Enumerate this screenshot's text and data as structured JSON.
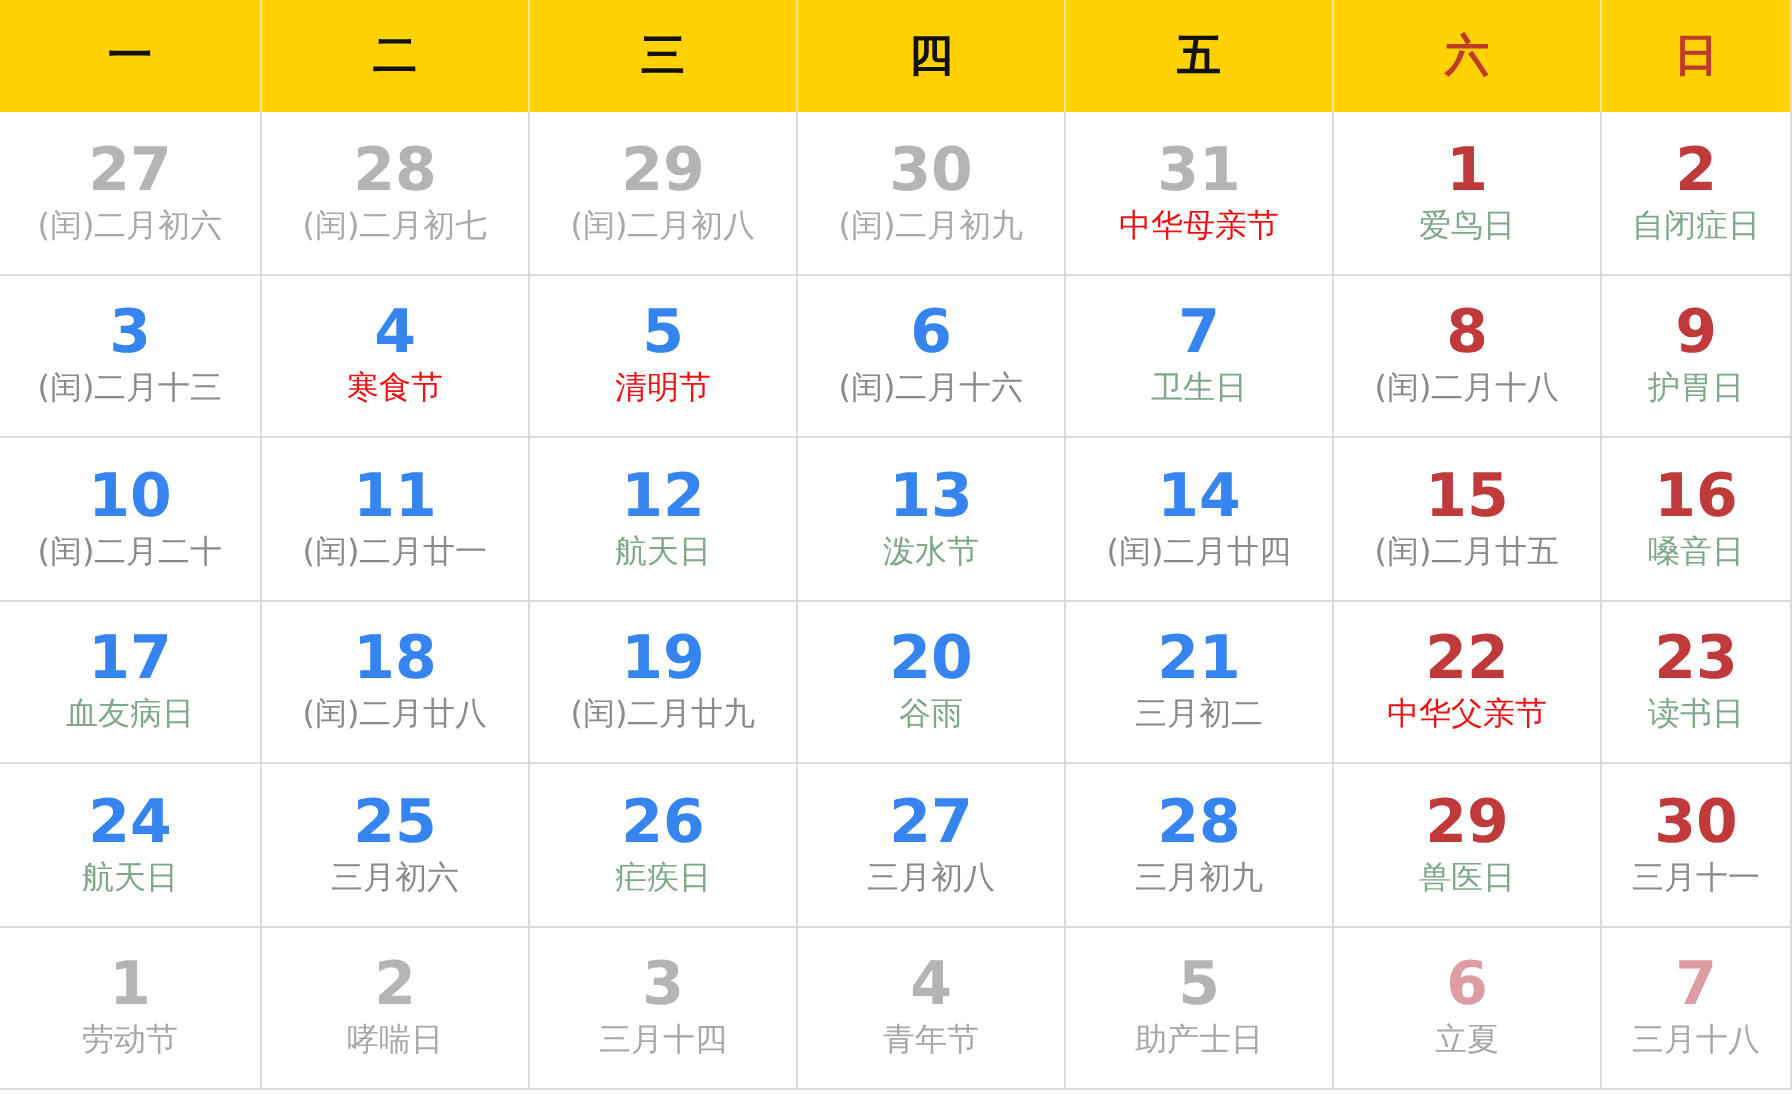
{
  "weekdays": [
    {
      "label": "一",
      "weekend": false
    },
    {
      "label": "二",
      "weekend": false
    },
    {
      "label": "三",
      "weekend": false
    },
    {
      "label": "四",
      "weekend": false
    },
    {
      "label": "五",
      "weekend": false
    },
    {
      "label": "六",
      "weekend": true
    },
    {
      "label": "日",
      "weekend": true
    }
  ],
  "weeks": [
    [
      {
        "day": "27",
        "note": "(闰)二月初六",
        "kind": "lunar",
        "other_month": true,
        "weekend": false
      },
      {
        "day": "28",
        "note": "(闰)二月初七",
        "kind": "lunar",
        "other_month": true,
        "weekend": false
      },
      {
        "day": "29",
        "note": "(闰)二月初八",
        "kind": "lunar",
        "other_month": true,
        "weekend": false
      },
      {
        "day": "30",
        "note": "(闰)二月初九",
        "kind": "lunar",
        "other_month": true,
        "weekend": false
      },
      {
        "day": "31",
        "note": "中华母亲节",
        "kind": "festival",
        "other_month": true,
        "weekend": false
      },
      {
        "day": "1",
        "note": "爱鸟日",
        "kind": "observance",
        "other_month": false,
        "weekend": true
      },
      {
        "day": "2",
        "note": "自闭症日",
        "kind": "observance",
        "other_month": false,
        "weekend": true
      }
    ],
    [
      {
        "day": "3",
        "note": "(闰)二月十三",
        "kind": "lunar",
        "other_month": false,
        "weekend": false
      },
      {
        "day": "4",
        "note": "寒食节",
        "kind": "festival",
        "other_month": false,
        "weekend": false
      },
      {
        "day": "5",
        "note": "清明节",
        "kind": "festival",
        "other_month": false,
        "weekend": false
      },
      {
        "day": "6",
        "note": "(闰)二月十六",
        "kind": "lunar",
        "other_month": false,
        "weekend": false
      },
      {
        "day": "7",
        "note": "卫生日",
        "kind": "observance",
        "other_month": false,
        "weekend": false
      },
      {
        "day": "8",
        "note": "(闰)二月十八",
        "kind": "lunar",
        "other_month": false,
        "weekend": true
      },
      {
        "day": "9",
        "note": "护胃日",
        "kind": "observance",
        "other_month": false,
        "weekend": true
      }
    ],
    [
      {
        "day": "10",
        "note": "(闰)二月二十",
        "kind": "lunar",
        "other_month": false,
        "weekend": false
      },
      {
        "day": "11",
        "note": "(闰)二月廿一",
        "kind": "lunar",
        "other_month": false,
        "weekend": false
      },
      {
        "day": "12",
        "note": "航天日",
        "kind": "observance",
        "other_month": false,
        "weekend": false
      },
      {
        "day": "13",
        "note": "泼水节",
        "kind": "observance",
        "other_month": false,
        "weekend": false
      },
      {
        "day": "14",
        "note": "(闰)二月廿四",
        "kind": "lunar",
        "other_month": false,
        "weekend": false
      },
      {
        "day": "15",
        "note": "(闰)二月廿五",
        "kind": "lunar",
        "other_month": false,
        "weekend": true
      },
      {
        "day": "16",
        "note": "嗓音日",
        "kind": "observance",
        "other_month": false,
        "weekend": true
      }
    ],
    [
      {
        "day": "17",
        "note": "血友病日",
        "kind": "observance",
        "other_month": false,
        "weekend": false
      },
      {
        "day": "18",
        "note": "(闰)二月廿八",
        "kind": "lunar",
        "other_month": false,
        "weekend": false
      },
      {
        "day": "19",
        "note": "(闰)二月廿九",
        "kind": "lunar",
        "other_month": false,
        "weekend": false
      },
      {
        "day": "20",
        "note": "谷雨",
        "kind": "observance",
        "other_month": false,
        "weekend": false
      },
      {
        "day": "21",
        "note": "三月初二",
        "kind": "lunar",
        "other_month": false,
        "weekend": false
      },
      {
        "day": "22",
        "note": "中华父亲节",
        "kind": "festival",
        "other_month": false,
        "weekend": true
      },
      {
        "day": "23",
        "note": "读书日",
        "kind": "observance",
        "other_month": false,
        "weekend": true
      }
    ],
    [
      {
        "day": "24",
        "note": "航天日",
        "kind": "observance",
        "other_month": false,
        "weekend": false
      },
      {
        "day": "25",
        "note": "三月初六",
        "kind": "lunar",
        "other_month": false,
        "weekend": false
      },
      {
        "day": "26",
        "note": "疟疾日",
        "kind": "observance",
        "other_month": false,
        "weekend": false
      },
      {
        "day": "27",
        "note": "三月初八",
        "kind": "lunar",
        "other_month": false,
        "weekend": false
      },
      {
        "day": "28",
        "note": "三月初九",
        "kind": "lunar",
        "other_month": false,
        "weekend": false
      },
      {
        "day": "29",
        "note": "兽医日",
        "kind": "observance",
        "other_month": false,
        "weekend": true
      },
      {
        "day": "30",
        "note": "三月十一",
        "kind": "lunar",
        "other_month": false,
        "weekend": true
      }
    ],
    [
      {
        "day": "1",
        "note": "劳动节",
        "kind": "observance",
        "other_month": true,
        "weekend": false
      },
      {
        "day": "2",
        "note": "哮喘日",
        "kind": "observance",
        "other_month": true,
        "weekend": false
      },
      {
        "day": "3",
        "note": "三月十四",
        "kind": "lunar",
        "other_month": true,
        "weekend": false
      },
      {
        "day": "4",
        "note": "青年节",
        "kind": "observance",
        "other_month": true,
        "weekend": false
      },
      {
        "day": "5",
        "note": "助产士日",
        "kind": "observance",
        "other_month": true,
        "weekend": false
      },
      {
        "day": "6",
        "note": "立夏",
        "kind": "observance",
        "other_month": true,
        "weekend": true
      },
      {
        "day": "7",
        "note": "三月十八",
        "kind": "lunar",
        "other_month": true,
        "weekend": true
      }
    ]
  ]
}
